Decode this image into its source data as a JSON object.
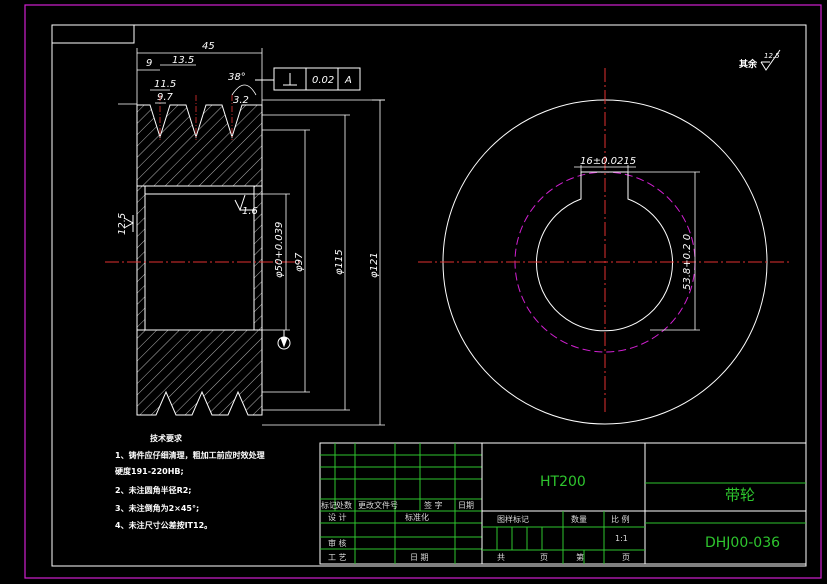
{
  "drawing": {
    "roughness_label": "其余",
    "roughness_value": "12.5",
    "dims": {
      "width_total": "45",
      "d9": "9",
      "d13_5": "13.5",
      "d11_5": "11.5",
      "d9_7": "9.7",
      "angle": "38°",
      "tol_value": "0.02",
      "datum": "A",
      "ra_left": "12.5",
      "ra_bore": "1.6",
      "ra_groove": "3.2",
      "dia_bore": "φ50+0.039",
      "dia_97": "φ97",
      "dia_115": "φ115",
      "dia_121": "φ121",
      "keyway_width": "16±0.0215",
      "keyway_depth": "53.8+0.2 0"
    },
    "tech_title": "技术要求",
    "tech_notes": [
      "1、铸件应仔细清理，粗加工前应时效处理",
      "   硬度191-220HB;",
      "2、未注圆角半径R2;",
      "3、未注倒角为2×45°;",
      "4、未注尺寸公差按IT12。"
    ]
  },
  "titleblock": {
    "material": "HT200",
    "part_name": "带轮",
    "drawing_no": "DHJ00-036",
    "headers": [
      "标记",
      "处数",
      "更改文件号",
      "签 字",
      "日期"
    ],
    "row_design": [
      "设 计",
      "标准化"
    ],
    "row_check": "审 核",
    "row_process": [
      "工 艺",
      "日 期"
    ],
    "info_headers": [
      "图样标记",
      "数量",
      "比 例"
    ],
    "scale": "1:1",
    "sheets": [
      "共",
      "页",
      "第",
      "页"
    ]
  }
}
